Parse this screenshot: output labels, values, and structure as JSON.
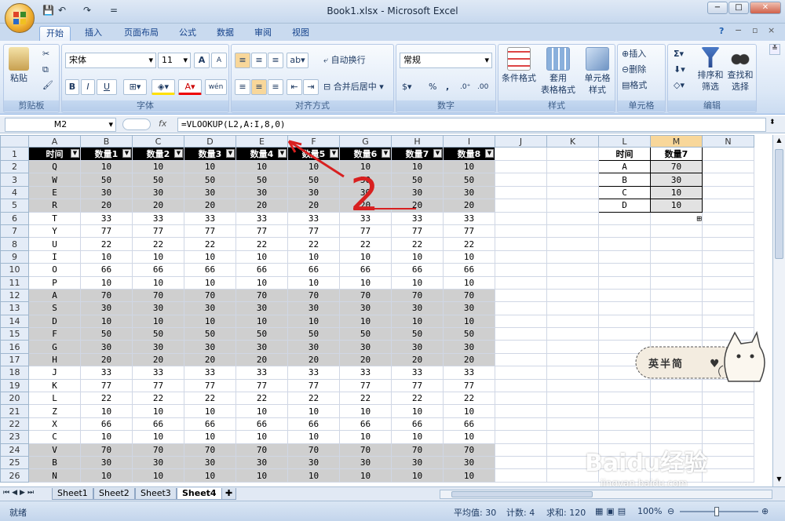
{
  "window": {
    "title": "Book1.xlsx - Microsoft Excel"
  },
  "quick_access": {
    "save": "💾",
    "undo": "↶",
    "redo": "↷",
    "more": "="
  },
  "window_controls": {
    "minimize": "−",
    "maximize": "□",
    "close": "✕"
  },
  "tabs": [
    "开始",
    "插入",
    "页面布局",
    "公式",
    "数据",
    "审阅",
    "视图"
  ],
  "ribbon": {
    "clipboard": {
      "label": "剪贴板",
      "paste": "粘贴"
    },
    "font": {
      "label": "字体",
      "name": "宋体",
      "size": "11",
      "bold": "B",
      "italic": "I",
      "underline": "U",
      "grow": "A",
      "shrink": "A",
      "phonetic": "wén"
    },
    "align": {
      "label": "对齐方式",
      "wrap": "自动换行",
      "merge": "合并后居中"
    },
    "number": {
      "label": "数字",
      "format": "常规",
      "percent": "%",
      "comma": ","
    },
    "styles": {
      "label": "样式",
      "cond": "条件格式",
      "table": "套用\n表格格式",
      "cell": "单元格\n样式"
    },
    "cells": {
      "label": "单元格",
      "insert": "插入",
      "delete": "删除",
      "format": "格式"
    },
    "edit": {
      "label": "编辑",
      "sigma": "Σ",
      "sort": "排序和\n筛选",
      "find": "查找和\n选择"
    }
  },
  "formula_bar": {
    "name_box": "M2",
    "fx": "fx",
    "formula": "=VLOOKUP(L2,A:I,8,0)"
  },
  "columns": [
    "A",
    "B",
    "C",
    "D",
    "E",
    "F",
    "G",
    "H",
    "I",
    "J",
    "K",
    "L",
    "M",
    "N"
  ],
  "headers": [
    "时间",
    "数量1",
    "数量2",
    "数量3",
    "数量4",
    "数量5",
    "数量6",
    "数量7",
    "数量8"
  ],
  "rows": [
    {
      "n": "2",
      "k": "Q",
      "v": "10"
    },
    {
      "n": "3",
      "k": "W",
      "v": "50"
    },
    {
      "n": "4",
      "k": "E",
      "v": "30"
    },
    {
      "n": "5",
      "k": "R",
      "v": "20"
    },
    {
      "n": "6",
      "k": "T",
      "v": "33"
    },
    {
      "n": "7",
      "k": "Y",
      "v": "77"
    },
    {
      "n": "8",
      "k": "U",
      "v": "22"
    },
    {
      "n": "9",
      "k": "I",
      "v": "10"
    },
    {
      "n": "10",
      "k": "O",
      "v": "66"
    },
    {
      "n": "11",
      "k": "P",
      "v": "10"
    },
    {
      "n": "12",
      "k": "A",
      "v": "70"
    },
    {
      "n": "13",
      "k": "S",
      "v": "30"
    },
    {
      "n": "14",
      "k": "D",
      "v": "10"
    },
    {
      "n": "15",
      "k": "F",
      "v": "50"
    },
    {
      "n": "16",
      "k": "G",
      "v": "30"
    },
    {
      "n": "17",
      "k": "H",
      "v": "20"
    },
    {
      "n": "18",
      "k": "J",
      "v": "33"
    },
    {
      "n": "19",
      "k": "K",
      "v": "77"
    },
    {
      "n": "20",
      "k": "L",
      "v": "22"
    },
    {
      "n": "21",
      "k": "Z",
      "v": "10"
    },
    {
      "n": "22",
      "k": "X",
      "v": "66"
    },
    {
      "n": "23",
      "k": "C",
      "v": "10"
    },
    {
      "n": "24",
      "k": "V",
      "v": "70"
    },
    {
      "n": "25",
      "k": "B",
      "v": "30"
    },
    {
      "n": "26",
      "k": "N",
      "v": "10"
    }
  ],
  "gray_rows": [
    "2",
    "3",
    "4",
    "5",
    "12",
    "13",
    "14",
    "15",
    "16",
    "17",
    "24",
    "25",
    "26"
  ],
  "lookup": {
    "header_l": "时间",
    "header_m": "数量7",
    "rows": [
      {
        "l": "A",
        "m": "70"
      },
      {
        "l": "B",
        "m": "30"
      },
      {
        "l": "C",
        "m": "10"
      },
      {
        "l": "D",
        "m": "10"
      }
    ]
  },
  "sheets": [
    "Sheet1",
    "Sheet2",
    "Sheet3",
    "Sheet4"
  ],
  "active_sheet": "Sheet4",
  "status": {
    "ready": "就绪",
    "avg": "平均值: 30",
    "count": "计数: 4",
    "sum": "求和: 120",
    "zoom": "100%"
  },
  "annotation": {
    "number": "2"
  },
  "sticker": {
    "text": "英半简"
  },
  "watermark": {
    "brand": "Baidu经验",
    "url": "jingyan.baidu.com"
  }
}
